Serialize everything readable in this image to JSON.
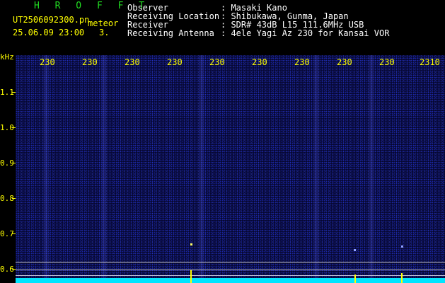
{
  "header": {
    "brand": "H R O F F T",
    "filename": "UT2506092300.pn",
    "meteor_label": "meteor",
    "datetime": "25.06.09 23:00",
    "count": "3.",
    "fields": [
      {
        "label": "Observer",
        "value": ": Masaki Kano"
      },
      {
        "label": "Receiving Location",
        "value": ": Shibukawa, Gunma, Japan"
      },
      {
        "label": "Receiver",
        "value": ": SDR# 43dB L15 111.6MHz USB"
      },
      {
        "label": "Receiving Antenna",
        "value": ": 4ele Yagi Az 230 for Kansai VOR"
      }
    ]
  },
  "axes": {
    "y_unit": "kHz",
    "y_ticks": [
      "1.1",
      "1.0",
      "0.9",
      "0.8",
      "0.7",
      "0.6"
    ],
    "x_ticks": [
      "230",
      "230",
      "230",
      "230",
      "230",
      "230",
      "230",
      "230",
      "230",
      "2310"
    ]
  },
  "colors": {
    "background": "#000000",
    "brand": "#22dd22",
    "labels": "#ffff00",
    "spectrum": "#00e5ff"
  }
}
